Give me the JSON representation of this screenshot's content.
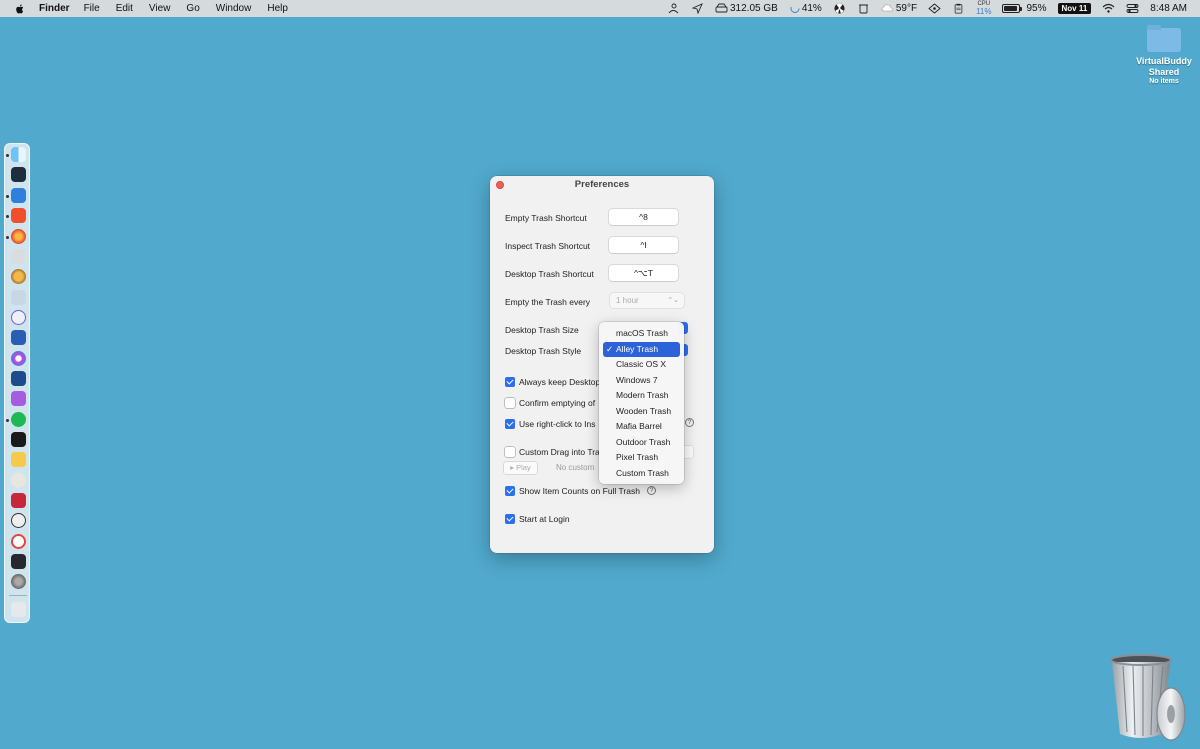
{
  "menubar": {
    "app_name": "Finder",
    "menus": [
      "File",
      "Edit",
      "View",
      "Go",
      "Window",
      "Help"
    ],
    "disk_free": "312.05 GB",
    "moon_percent": "41%",
    "weather": "59°F",
    "cpu_label": "CPU",
    "cpu_value": "11%",
    "battery": "95%",
    "date": "Nov 11",
    "time": "8:48 AM"
  },
  "desktop_folder": {
    "name_line1": "VirtualBuddy",
    "name_line2": "Shared",
    "subtitle": "No items"
  },
  "preferences": {
    "title": "Preferences",
    "empty_shortcut_label": "Empty Trash Shortcut",
    "empty_shortcut_value": "^8",
    "inspect_shortcut_label": "Inspect Trash Shortcut",
    "inspect_shortcut_value": "^I",
    "desktop_shortcut_label": "Desktop Trash Shortcut",
    "desktop_shortcut_value": "^⌥T",
    "empty_every_label": "Empty the Trash every",
    "empty_every_value": "1 hour",
    "size_label": "Desktop Trash Size",
    "style_label": "Desktop Trash Style",
    "always_keep_label": "Always keep Desktop",
    "confirm_label": "Confirm emptying of",
    "right_click_label": "Use right-click to Ins",
    "custom_drag_label": "Custom Drag into Tra",
    "play_label": "▸ Play",
    "no_custom_label": "No custom",
    "show_counts_label": "Show Item Counts on Full Trash",
    "start_login_label": "Start at Login"
  },
  "style_menu": {
    "selected": "Alley Trash",
    "check": "✓",
    "options": [
      "macOS Trash",
      "Alley Trash",
      "Classic OS X",
      "Windows 7",
      "Modern Trash",
      "Wooden Trash",
      "Mafia Barrel",
      "Outdoor Trash",
      "Pixel Trash",
      "Custom Trash"
    ]
  },
  "colors": {
    "desktop": "#51a9cd",
    "accent": "#2c6ef2",
    "close": "#ec5f56"
  }
}
